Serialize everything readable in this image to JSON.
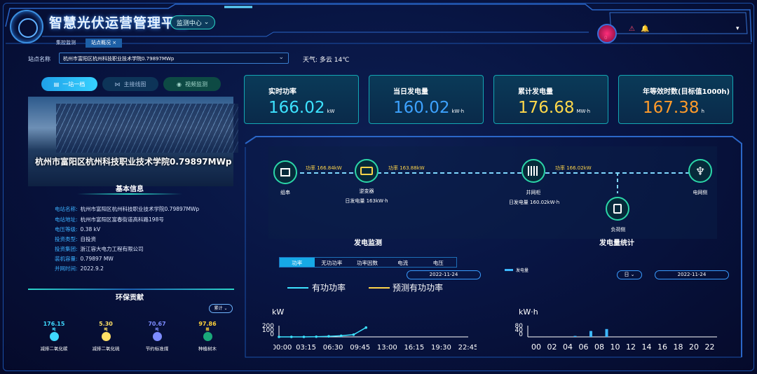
{
  "header": {
    "title": "智慧光伏运营管理平台",
    "module_btn": "监测中心",
    "tabs": [
      "集控监测",
      "站点概况 ×"
    ],
    "alarm_count": "0"
  },
  "site": {
    "label": "站点名称",
    "value": "杭州市富阳区杭州科技职业技术学院0.79897MWp",
    "weather": "天气: 多云  14℃"
  },
  "left_buttons": [
    "一站一档",
    "主接线图",
    "视频监测"
  ],
  "station_name": "杭州市富阳区杭州科技职业技术学院0.79897MWp",
  "basic": {
    "title": "基本信息",
    "rows": [
      {
        "k": "电站名称:",
        "v": "杭州市富阳区杭州科技职业技术学院0.79897MWp"
      },
      {
        "k": "电站地址:",
        "v": "杭州市富阳区富春街道高科路198号"
      },
      {
        "k": "电压等级:",
        "v": "0.38 kV"
      },
      {
        "k": "投资类型:",
        "v": "自投资"
      },
      {
        "k": "投资集团:",
        "v": "浙江容大电力工程有限公司"
      },
      {
        "k": "装机容量:",
        "v": "0.79897 MW"
      },
      {
        "k": "并网时间:",
        "v": "2022.9.2"
      }
    ]
  },
  "eco": {
    "title": "环保贡献",
    "filter": "累计",
    "items": [
      {
        "value": "176.15",
        "unit": "吨",
        "label": "减排二氧化碳",
        "color": "#3fd9ff"
      },
      {
        "value": "5.30",
        "unit": "吨",
        "label": "减排二氧化硫",
        "color": "#ffe066"
      },
      {
        "value": "70.67",
        "unit": "吨",
        "label": "节约标准煤",
        "color": "#7d8cff"
      },
      {
        "value": "97.86",
        "unit": "棵",
        "label": "种植树木",
        "color": "#ffd23a"
      }
    ]
  },
  "kpis": [
    {
      "label": "实时功率",
      "value": "166.02",
      "unit": "kW",
      "color": "#3de2ff"
    },
    {
      "label": "当日发电量",
      "value": "160.02",
      "unit": "kW·h",
      "color": "#3da2ff"
    },
    {
      "label": "累计发电量",
      "value": "176.68",
      "unit": "MW·h",
      "color": "#ffd84a"
    },
    {
      "label": "年等效时数(目标值1000h)",
      "value": "167.38",
      "unit": "h",
      "color": "#ff9b2b"
    }
  ],
  "flow": {
    "nodes": [
      {
        "label": "组串"
      },
      {
        "label": "逆变器",
        "sub": "日发电量 163kW·h"
      },
      {
        "label": "并网柜",
        "sub": "日发电量 160.02kW·h"
      },
      {
        "label": "电网侧"
      },
      {
        "label": "负荷侧"
      }
    ],
    "powers": [
      "功率 166.84kW",
      "功率 163.88kW",
      "功率 166.02kW"
    ]
  },
  "monitor": {
    "title": "发电监测",
    "tabs": [
      "功率",
      "无功功率",
      "功率因数",
      "电流",
      "电压"
    ],
    "date": "2022-11-24",
    "legend": [
      "有功功率",
      "预测有功功率"
    ],
    "y_unit": "kW",
    "y_ticks": [
      "200",
      "100",
      "0"
    ]
  },
  "stats": {
    "title": "发电量统计",
    "legend": "发电量",
    "period": "日",
    "date": "2022-11-24",
    "y_unit": "kW·h",
    "y_ticks": [
      "80",
      "40",
      "0"
    ]
  },
  "chart_data": [
    {
      "type": "line",
      "title": "发电监测",
      "x": [
        "00:00",
        "03:15",
        "06:30",
        "09:45",
        "13:00",
        "16:15",
        "19:30",
        "22:45"
      ],
      "series": [
        {
          "name": "有功功率",
          "values": [
            0,
            0,
            0,
            3,
            10,
            20,
            40,
            166
          ]
        },
        {
          "name": "预测有功功率",
          "values": []
        }
      ],
      "ylabel": "kW",
      "ylim": [
        0,
        200
      ]
    },
    {
      "type": "bar",
      "title": "发电量统计",
      "categories": [
        "00",
        "02",
        "04",
        "06",
        "08",
        "10",
        "12",
        "14",
        "16",
        "18",
        "20",
        "22"
      ],
      "series": [
        {
          "name": "发电量",
          "values": [
            0,
            0,
            0,
            5,
            30,
            40,
            0,
            0,
            0,
            0,
            0,
            0
          ]
        }
      ],
      "ylabel": "kW·h",
      "ylim": [
        0,
        80
      ]
    }
  ],
  "colors": {
    "accent": "#2bd6c8",
    "kpi_border": "#13a7b4"
  }
}
